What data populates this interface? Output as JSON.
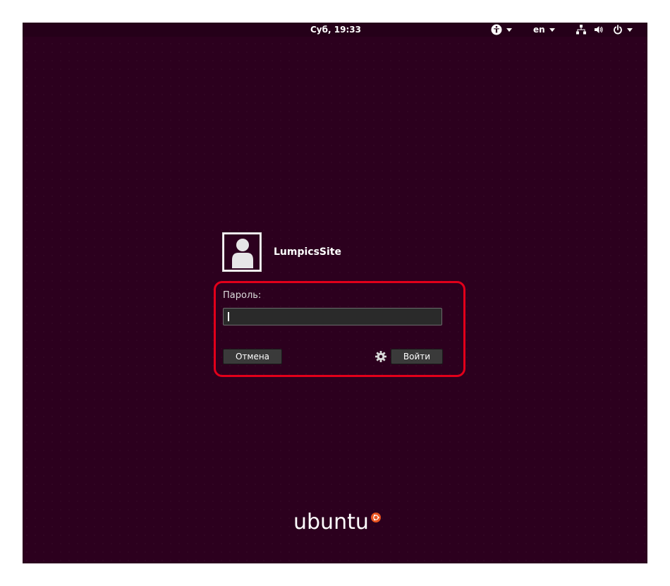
{
  "topbar": {
    "clock": "Суб, 19:33",
    "language": "en",
    "icons": [
      "accessibility-icon",
      "network-icon",
      "volume-icon",
      "power-icon"
    ]
  },
  "user": {
    "name": "LumpicsSite"
  },
  "login": {
    "password_label": "Пароль:",
    "password_value": "",
    "cancel_label": "Отмена",
    "submit_label": "Войти"
  },
  "branding": {
    "logo_text": "ubuntu"
  },
  "colors": {
    "background": "#2c001e",
    "highlight": "#e2001a",
    "brand_orange": "#e95420"
  }
}
